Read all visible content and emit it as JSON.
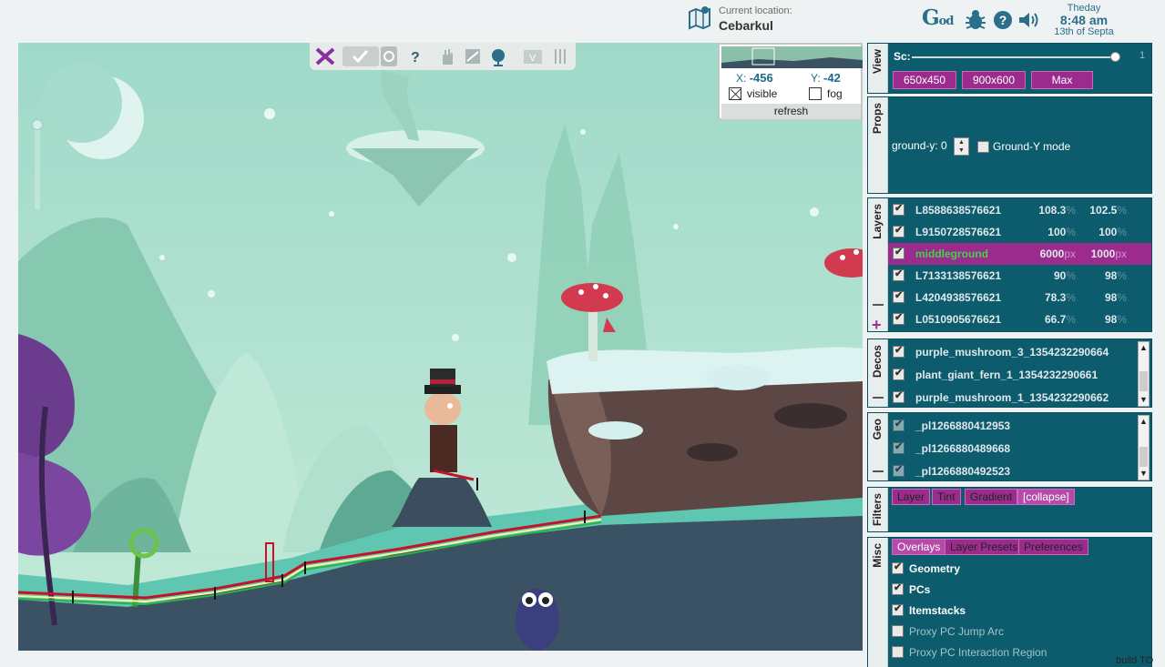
{
  "top": {
    "location_label": "Current location:",
    "location_name": "Cebarkul",
    "logo": "God",
    "icons": [
      "map-icon",
      "bug-icon",
      "help-icon",
      "sound-icon"
    ],
    "clock": {
      "day": "Theday",
      "time": "8:48 am",
      "date": "13th of Septa"
    }
  },
  "toolbar": {
    "icons": [
      "cross-tools-icon",
      "check-icon",
      "circle-icon",
      "hint-icon",
      "hand-icon",
      "pan-icon",
      "globe-icon",
      "v-icon",
      "columns-icon"
    ]
  },
  "minimap": {
    "x_label": "X:",
    "x": "-456",
    "y_label": "Y:",
    "y": "-42",
    "visible_label": "visible",
    "visible_checked": true,
    "fog_label": "fog",
    "fog_checked": false,
    "refresh_label": "refresh"
  },
  "view": {
    "tab": "View",
    "scale_label": "Sc:",
    "scale_value": "1",
    "scale_level": 1.0,
    "buttons": [
      "650x450",
      "900x600",
      "Max"
    ]
  },
  "props": {
    "tab": "Props",
    "ground_label": "ground-y: 0",
    "ground_mode_label": "Ground-Y mode",
    "ground_mode_checked": false
  },
  "layers": {
    "tab": "Layers",
    "rows": [
      {
        "name": "L8588638576621",
        "v1": "108.3",
        "u1": "%",
        "v2": "102.5",
        "u2": "%",
        "checked": true,
        "selected": false
      },
      {
        "name": "L9150728576621",
        "v1": "100",
        "u1": "%",
        "v2": "100",
        "u2": "%",
        "checked": true,
        "selected": false
      },
      {
        "name": "middleground",
        "v1": "6000",
        "u1": "px",
        "v2": "1000",
        "u2": "px",
        "checked": true,
        "selected": true
      },
      {
        "name": "L7133138576621",
        "v1": "90",
        "u1": "%",
        "v2": "98",
        "u2": "%",
        "checked": true,
        "selected": false
      },
      {
        "name": "L4204938576621",
        "v1": "78.3",
        "u1": "%",
        "v2": "98",
        "u2": "%",
        "checked": true,
        "selected": false
      },
      {
        "name": "L0510905676621",
        "v1": "66.7",
        "u1": "%",
        "v2": "98",
        "u2": "%",
        "checked": true,
        "selected": false
      }
    ],
    "selected_color": "#3fd24a"
  },
  "decos": {
    "tab": "Decos",
    "rows": [
      "purple_mushroom_3_1354232290664",
      "plant_giant_fern_1_1354232290661",
      "purple_mushroom_1_1354232290662"
    ]
  },
  "geo": {
    "tab": "Geo",
    "rows": [
      "_pl1266880412953",
      "_pl1266880489668",
      "_pl1266880492523"
    ]
  },
  "filters": {
    "tab": "Filters",
    "tabs": [
      "Layer",
      "Tint",
      "Gradient",
      "[collapse]"
    ]
  },
  "misc": {
    "tab": "Misc",
    "tabs": [
      "Overlays",
      "Layer Presets",
      "Preferences"
    ],
    "rows": [
      {
        "label": "Geometry",
        "checked": true
      },
      {
        "label": "PCs",
        "checked": true
      },
      {
        "label": "Itemstacks",
        "checked": true
      },
      {
        "label": "Proxy PC Jump Arc",
        "checked": false
      },
      {
        "label": "Proxy PC Interaction Region",
        "checked": false
      }
    ]
  },
  "build_tag": "build TO",
  "colors": {
    "panel": "#0d5c6e",
    "accent": "#9b2c8e",
    "sky": "#a6dccc"
  }
}
